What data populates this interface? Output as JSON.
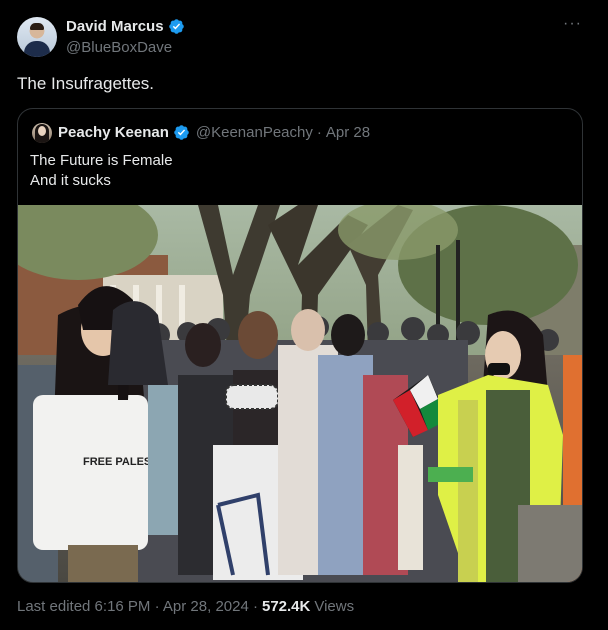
{
  "author": {
    "display_name": "David Marcus",
    "handle": "@BlueBoxDave",
    "verified": true,
    "avatar_icon": "profile-photo"
  },
  "menu": {
    "more_label": "···"
  },
  "tweet": {
    "text": "The Insufragettes."
  },
  "quoted": {
    "display_name": "Peachy Keenan",
    "handle": "@KeenanPeachy",
    "separator": "·",
    "date": "Apr 28",
    "verified": true,
    "lines": [
      "The Future is Female",
      "And it sucks"
    ],
    "photo": {
      "subject": "crowd-protest-photo",
      "shirt_text": "FREE PALES"
    }
  },
  "footer": {
    "edited": "Last edited 6:16 PM · Apr 28, 2024 ·",
    "views_count": "572.4K",
    "views_label": "Views"
  },
  "colors": {
    "background": "#000000",
    "text_primary": "#e7e9ea",
    "text_secondary": "#71767b",
    "border": "#2f3336",
    "verified_blue": "#1d9bf0"
  }
}
